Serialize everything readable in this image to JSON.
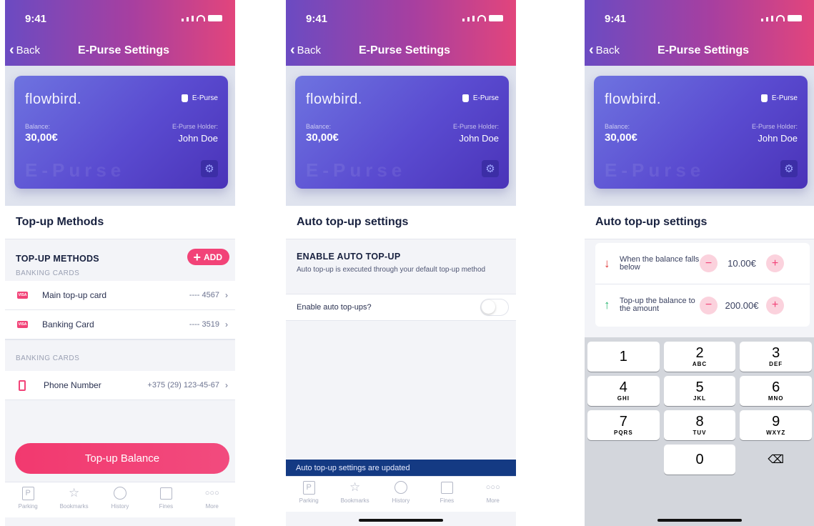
{
  "status": {
    "time": "9:41"
  },
  "nav": {
    "back_label": "Back",
    "title": "E-Purse Settings"
  },
  "card": {
    "brand": "flowbird.",
    "type_label": "E-Purse",
    "balance_label": "Balance:",
    "balance": "30,00€",
    "holder_label": "E-Purse Holder:",
    "holder": "John Doe",
    "watermark": "E-Purse"
  },
  "screen1": {
    "section_title": "Top-up Methods",
    "group_title": "TOP-UP METHODS",
    "add_label": "ADD",
    "group_sub": "BANKING CARDS",
    "cards": [
      {
        "label": "Main top-up card",
        "value": "---- 4567"
      },
      {
        "label": "Banking Card",
        "value": "---- 3519"
      }
    ],
    "group2_title": "BANKING CARDS",
    "phone": {
      "label": "Phone Number",
      "value": "+375 (29) 123-45-67"
    },
    "cta": "Top-up Balance"
  },
  "screen2": {
    "section_title": "Auto top-up settings",
    "toggle_title": "ENABLE AUTO TOP-UP",
    "toggle_desc": "Auto top-up is executed through your default top-up method",
    "toggle_label": "Enable auto top-ups?",
    "toast": "Auto top-up settings are updated"
  },
  "screen3": {
    "section_title": "Auto top-up settings",
    "rows": [
      {
        "label": "When the balance falls below",
        "value": "10.00€"
      },
      {
        "label": "Top-up the balance to the amount",
        "value": "200.00€"
      }
    ],
    "keys": [
      {
        "num": "1",
        "letters": ""
      },
      {
        "num": "2",
        "letters": "ABC"
      },
      {
        "num": "3",
        "letters": "DEF"
      },
      {
        "num": "4",
        "letters": "GHI"
      },
      {
        "num": "5",
        "letters": "JKL"
      },
      {
        "num": "6",
        "letters": "MNO"
      },
      {
        "num": "7",
        "letters": "PQRS"
      },
      {
        "num": "8",
        "letters": "TUV"
      },
      {
        "num": "9",
        "letters": "WXYZ"
      },
      {
        "num": "0",
        "letters": ""
      }
    ]
  },
  "tabs": [
    {
      "label": "Parking",
      "icon": "parking-icon"
    },
    {
      "label": "Bookmarks",
      "icon": "star-icon"
    },
    {
      "label": "History",
      "icon": "clock-icon"
    },
    {
      "label": "Fines",
      "icon": "fines-icon"
    },
    {
      "label": "More",
      "icon": "more-icon"
    }
  ],
  "colors": {
    "accent": "#f24378",
    "header_start": "#6b4bc2",
    "header_end": "#e2457c",
    "toast": "#143a83"
  }
}
